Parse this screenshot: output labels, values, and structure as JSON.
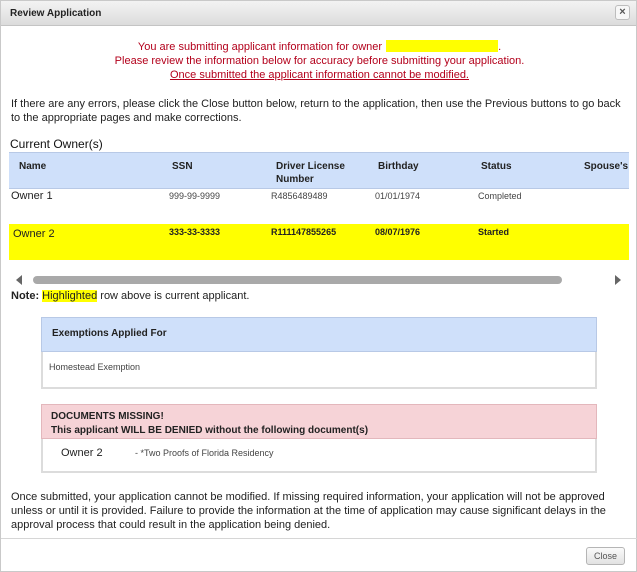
{
  "dialog": {
    "title": "Review Application"
  },
  "notice": {
    "line1_prefix": "You are submitting applicant information for owner",
    "line1_suffix": ".",
    "line2": "Please review the information below for accuracy before submitting your application.",
    "line3": "Once submitted the applicant information cannot be modified."
  },
  "instructions": "If there are any errors, please click the Close button below, return to the application, then use the Previous buttons to go back to the appropriate pages and make corrections.",
  "owners_section": {
    "title": "Current Owner(s)",
    "columns": [
      "Name",
      "SSN",
      "Driver License Number",
      "Birthday",
      "Status",
      "Spouse's"
    ],
    "rows": [
      {
        "name": "Owner 1",
        "ssn": "999-99-9999",
        "license": "R4856489489",
        "birthday": "01/01/1974",
        "status": "Completed",
        "highlighted": false
      },
      {
        "name": "Owner 2",
        "ssn": "333-33-3333",
        "license": "R111147855265",
        "birthday": "08/07/1976",
        "status": "Started",
        "highlighted": true
      }
    ]
  },
  "note": {
    "label": "Note:",
    "highlight": "Highlighted",
    "rest": " row above is current applicant."
  },
  "exemptions": {
    "heading": "Exemptions Applied For",
    "items": [
      "Homestead Exemption"
    ]
  },
  "documents": {
    "heading_line1": "DOCUMENTS MISSING!",
    "heading_line2": "This applicant WILL BE DENIED without the following document(s)",
    "owner": "Owner 2",
    "items": [
      "- *Two Proofs of Florida Residency"
    ]
  },
  "footer_text": "Once submitted, your application cannot be modified. If missing required information, your application will not be approved unless or until it is provided. Failure to provide the information at the time of application may cause significant delays in the approval process that could result in the application being denied.",
  "buttons": {
    "close_label": "Close",
    "close_icon": "close-icon"
  },
  "colors": {
    "notice_red": "#b3001b",
    "highlight_yellow": "#ffff00",
    "header_blue": "#cfe0fa",
    "missing_pink": "#f6d3d7"
  }
}
